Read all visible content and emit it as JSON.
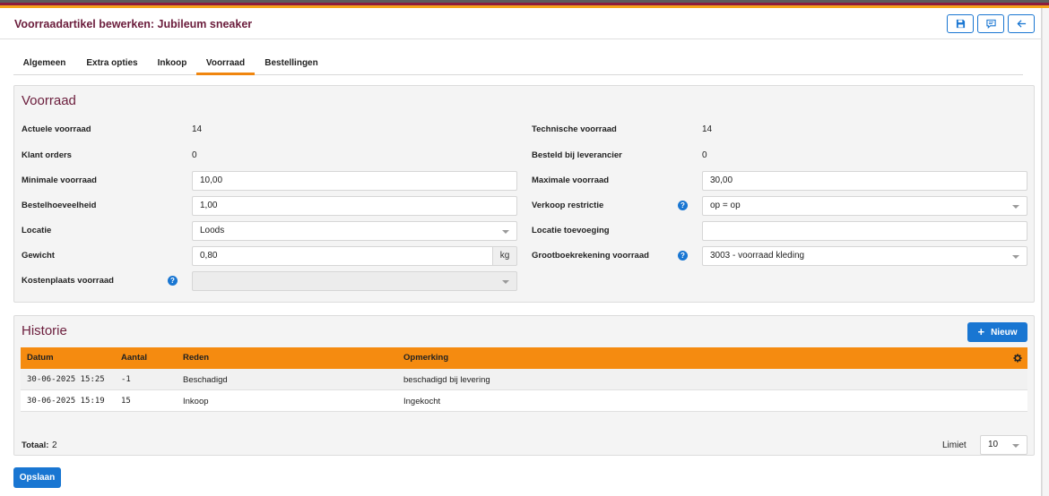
{
  "header": {
    "title": "Voorraadartikel bewerken: Jubileum sneaker",
    "icons": [
      "save-icon",
      "comment-icon",
      "arrow-left-icon"
    ]
  },
  "tabs": [
    {
      "label": "Algemeen",
      "active": false
    },
    {
      "label": "Extra opties",
      "active": false
    },
    {
      "label": "Inkoop",
      "active": false
    },
    {
      "label": "Voorraad",
      "active": true
    },
    {
      "label": "Bestellingen",
      "active": false
    }
  ],
  "voorraad": {
    "title": "Voorraad",
    "actuele_voorraad": {
      "label": "Actuele voorraad",
      "value": "14"
    },
    "klant_orders": {
      "label": "Klant orders",
      "value": "0"
    },
    "minimale_voorraad": {
      "label": "Minimale voorraad",
      "value": "10,00"
    },
    "bestelhoeveelheid": {
      "label": "Bestelhoeveelheid",
      "value": "1,00"
    },
    "locatie": {
      "label": "Locatie",
      "value": "Loods"
    },
    "gewicht": {
      "label": "Gewicht",
      "value": "0,80",
      "unit": "kg"
    },
    "kostenplaats": {
      "label": "Kostenplaats voorraad",
      "value": ""
    },
    "technische_voorraad": {
      "label": "Technische voorraad",
      "value": "14"
    },
    "besteld_bij_leverancier": {
      "label": "Besteld bij leverancier",
      "value": "0"
    },
    "maximale_voorraad": {
      "label": "Maximale voorraad",
      "value": "30,00"
    },
    "verkoop_restrictie": {
      "label": "Verkoop restrictie",
      "value": "op = op"
    },
    "locatie_toevoeging": {
      "label": "Locatie toevoeging",
      "value": ""
    },
    "grootboekrekening": {
      "label": "Grootboekrekening voorraad",
      "value": "3003 - voorraad kleding"
    },
    "help_glyph": "?"
  },
  "historie": {
    "title": "Historie",
    "new_button": {
      "icon": "+",
      "label": "Nieuw"
    },
    "columns": [
      "Datum",
      "Aantal",
      "Reden",
      "Opmerking"
    ],
    "rows": [
      {
        "datum": "30-06-2025 15:25",
        "aantal": "-1",
        "reden": "Beschadigd",
        "opmerking": "beschadigd bij levering"
      },
      {
        "datum": "30-06-2025 15:19",
        "aantal": "15",
        "reden": "Inkoop",
        "opmerking": "Ingekocht"
      }
    ],
    "totaal_label": "Totaal:",
    "totaal_value": "2",
    "limiet_label": "Limiet",
    "limiet_value": "10"
  },
  "footer": {
    "save_label": "Opslaan"
  },
  "colors": {
    "brand": "#6b1d3c",
    "accent": "#f58b10",
    "primary": "#1976d2"
  }
}
